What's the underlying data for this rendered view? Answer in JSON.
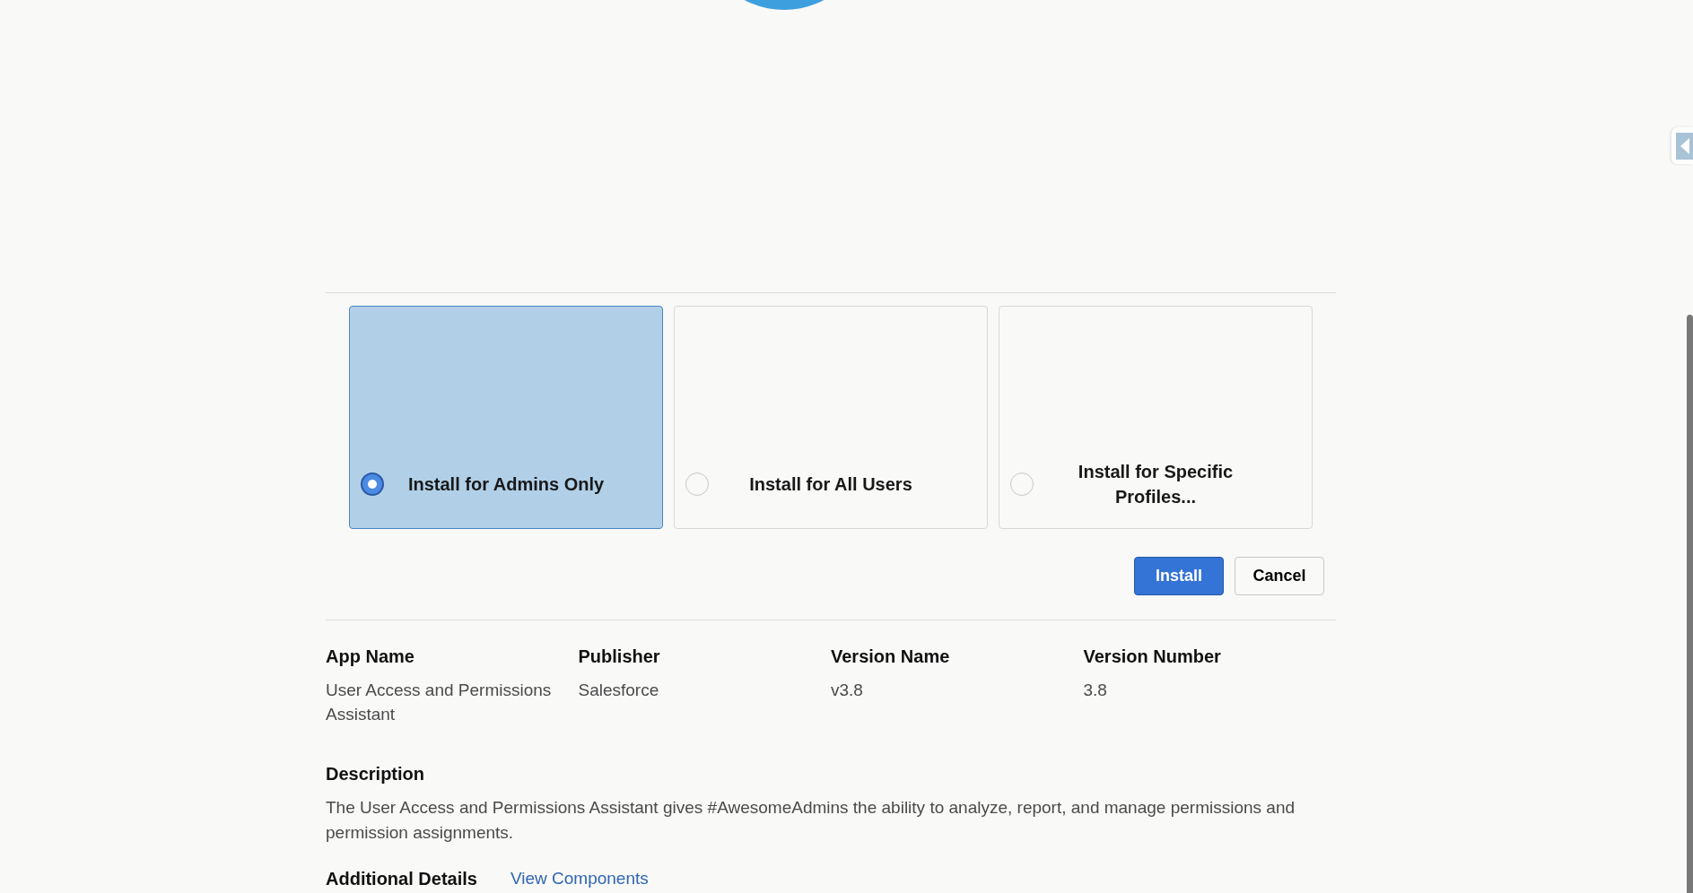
{
  "install_options": [
    {
      "label": "Install for Admins Only",
      "selected": true
    },
    {
      "label": "Install for All Users",
      "selected": false
    },
    {
      "label": "Install for Specific Profiles...",
      "selected": false
    }
  ],
  "buttons": [
    {
      "label": "Install",
      "kind": "primary"
    },
    {
      "label": "Cancel",
      "kind": "secondary"
    }
  ],
  "details": [
    {
      "heading": "App Name",
      "value": "User Access and Permissions Assistant"
    },
    {
      "heading": "Publisher",
      "value": "Salesforce"
    },
    {
      "heading": "Version Name",
      "value": "v3.8"
    },
    {
      "heading": "Version Number",
      "value": "3.8"
    }
  ],
  "description": {
    "heading": "Description",
    "text": "The User Access and Permissions Assistant gives #AwesomeAdmins the ability to analyze, report, and manage permissions and permission assignments."
  },
  "additional_details": {
    "heading": "Additional Details",
    "link": "View Components"
  }
}
